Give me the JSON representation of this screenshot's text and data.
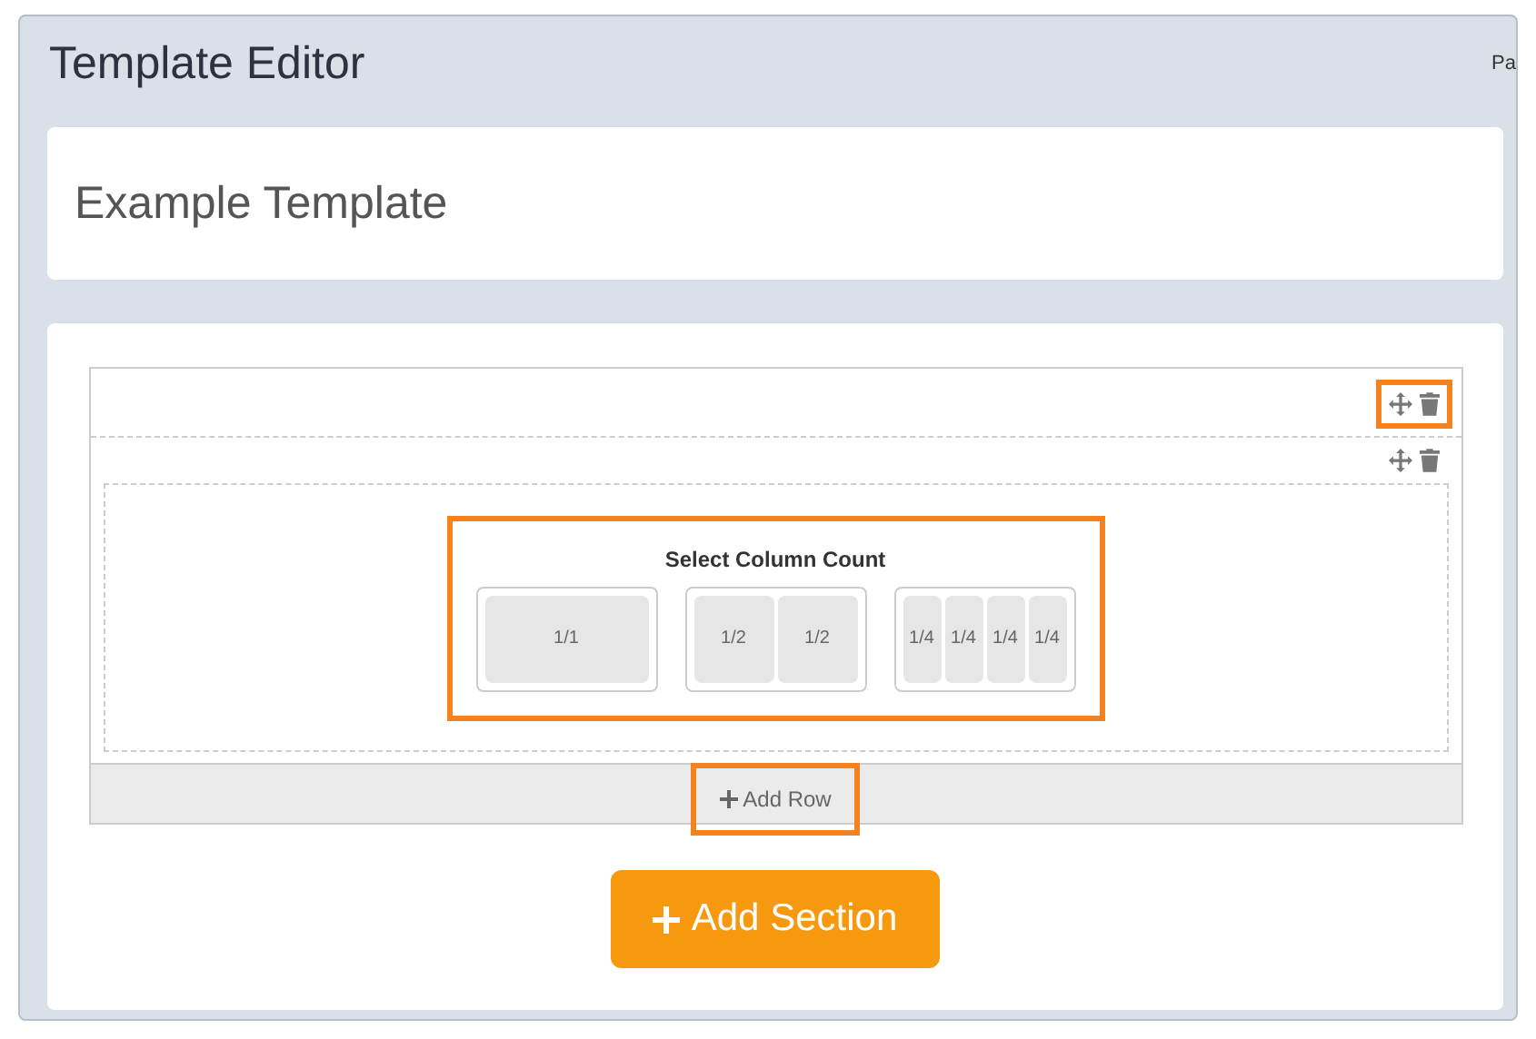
{
  "header": {
    "title": "Template Editor",
    "clipped_text": "Pa"
  },
  "template_name": {
    "value": "Example Template"
  },
  "section": {
    "tools_highlighted": true,
    "row": {
      "tools_highlighted": false,
      "column_selector": {
        "highlighted": true,
        "title": "Select Column Count",
        "options": [
          {
            "parts": [
              "1/1"
            ]
          },
          {
            "parts": [
              "1/2",
              "1/2"
            ]
          },
          {
            "parts": [
              "1/4",
              "1/4",
              "1/4",
              "1/4"
            ]
          }
        ]
      }
    },
    "add_row": {
      "label": "Add Row",
      "highlighted": true
    }
  },
  "add_section": {
    "label": "Add Section"
  }
}
